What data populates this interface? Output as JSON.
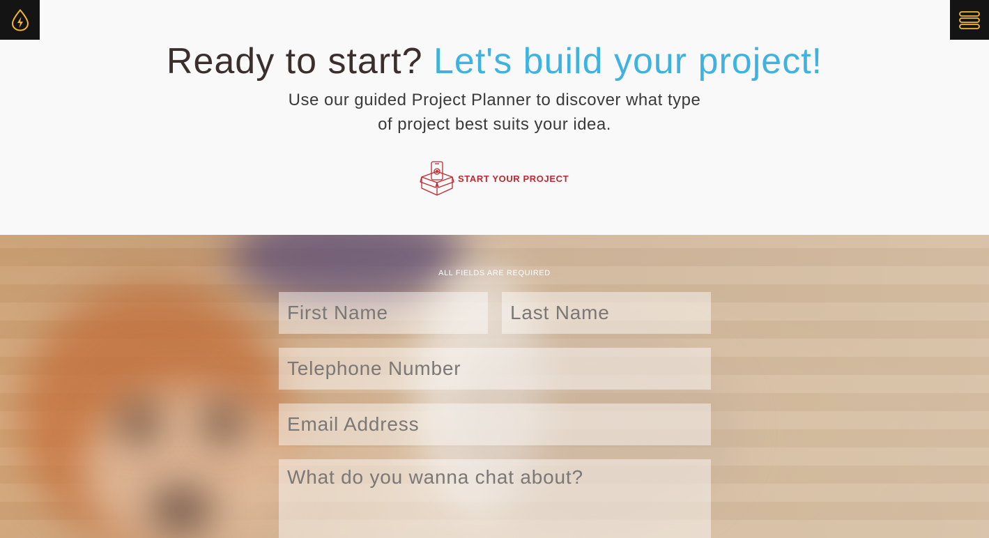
{
  "nav": {
    "logo_icon": "lightning-drop-icon",
    "menu_icon": "hamburger-menu-icon",
    "accent_color": "#f5b82e",
    "bar_color": "#141414"
  },
  "hero": {
    "headline_part1": "Ready to start?",
    "headline_part2": "Let's build your project!",
    "subtext_line1": "Use our guided Project Planner to discover what type",
    "subtext_line2": "of project best suits your idea.",
    "cta_label": "START YOUR PROJECT",
    "cta_icon": "box-phone-icon",
    "headline_color": "#3a2f2d",
    "highlight_color": "#3eb2e0",
    "cta_color": "#c0282e"
  },
  "form": {
    "required_note": "ALL FIELDS ARE REQUIRED",
    "first_name_placeholder": "First Name",
    "last_name_placeholder": "Last Name",
    "telephone_placeholder": "Telephone Number",
    "email_placeholder": "Email Address",
    "message_placeholder": "What do you wanna chat about?"
  }
}
